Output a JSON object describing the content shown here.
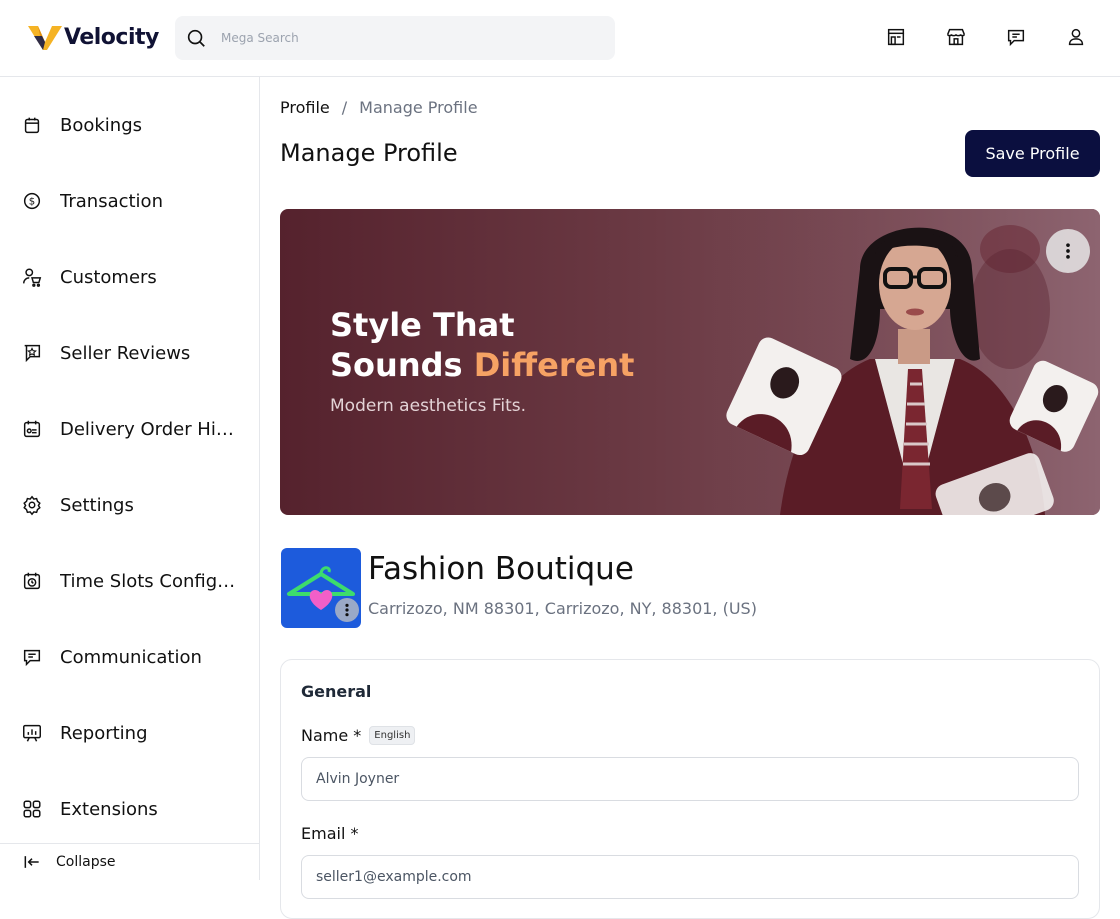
{
  "app": {
    "name": "Velocity",
    "brand_color": "#0b0f3f",
    "accent_color": "#f6a264"
  },
  "search": {
    "placeholder": "Mega Search"
  },
  "header_icons": [
    "storefront-icon",
    "store-icon",
    "chat-icon",
    "user-icon"
  ],
  "sidebar": {
    "items": [
      {
        "label": "Bookings",
        "icon": "calendar-icon"
      },
      {
        "label": "Transaction",
        "icon": "dollar-circle-icon"
      },
      {
        "label": "Customers",
        "icon": "customer-cart-icon"
      },
      {
        "label": "Seller Reviews",
        "icon": "review-star-icon"
      },
      {
        "label": "Delivery Order History",
        "icon": "delivery-calendar-icon"
      },
      {
        "label": "Settings",
        "icon": "gear-icon"
      },
      {
        "label": "Time Slots Configuration",
        "icon": "timer-calendar-icon"
      },
      {
        "label": "Communication",
        "icon": "message-icon"
      },
      {
        "label": "Reporting",
        "icon": "report-chart-icon"
      },
      {
        "label": "Extensions",
        "icon": "grid-icon"
      }
    ],
    "collapse_label": "Collapse"
  },
  "breadcrumb": {
    "root": "Profile",
    "separator": "/",
    "current": "Manage Profile"
  },
  "page": {
    "title": "Manage Profile",
    "save_label": "Save Profile"
  },
  "banner": {
    "line1": "Style That",
    "line2_prefix": "Sounds ",
    "line2_accent": "Different",
    "subtitle": "Modern aesthetics Fits."
  },
  "store": {
    "name": "Fashion Boutique",
    "address": "Carrizozo, NM 88301, Carrizozo, NY, 88301, (US)"
  },
  "form": {
    "section_title": "General",
    "name_label": "Name *",
    "name_lang": "English",
    "name_value": "Alvin Joyner",
    "email_label": "Email *",
    "email_value": "seller1@example.com"
  }
}
